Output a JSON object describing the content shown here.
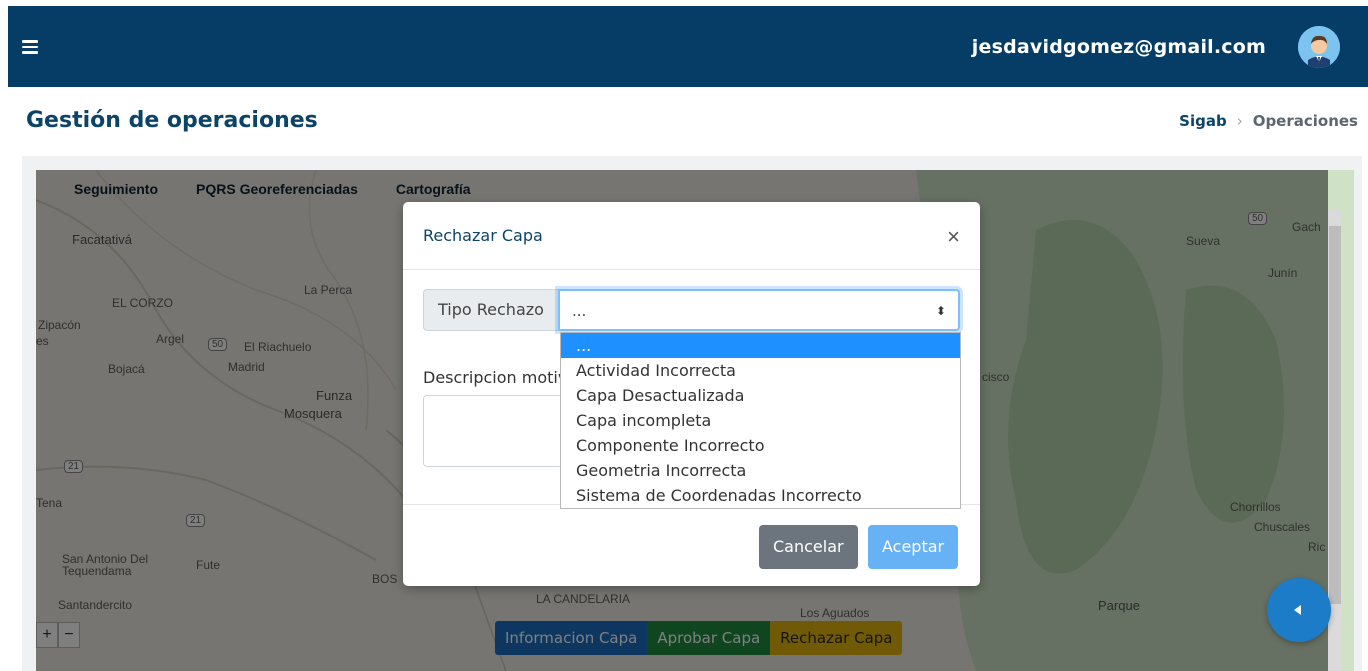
{
  "header": {
    "user_email": "jesdavidgomez@gmail.com"
  },
  "page": {
    "title": "Gestión de operaciones",
    "breadcrumb": [
      "Sigab",
      "Operaciones"
    ]
  },
  "map": {
    "tabs": [
      "Seguimiento",
      "PQRS Georeferenciadas",
      "Cartografía"
    ],
    "labels": {
      "facatativa": "Facatativá",
      "el_corzo": "EL CORZO",
      "la_perca": "La Perca",
      "zipacon": "Zipacón",
      "argel": "Argel",
      "el_riachuelo": "El Riachuelo",
      "bojaca": "Bojacá",
      "madrid": "Madrid",
      "funza": "Funza",
      "mosquera": "Mosquera",
      "tena": "Tena",
      "san_antonio": "San Antonio Del",
      "tequendama": "Tequendama",
      "fute": "Fute",
      "santandercito": "Santandercito",
      "la_candelaria": "LA CANDELARIA",
      "los_aguados": "Los Aguados",
      "sueva": "Sueva",
      "junin": "Junín",
      "gach": "Gach",
      "cisco": "cisco",
      "chorrillos": "Chorrillos",
      "chuscales": "Chuscales",
      "ric": "Ric",
      "parque": "Parque",
      "bos": "BOS",
      "es": "es"
    },
    "road_shields": [
      "50",
      "21",
      "21",
      "50",
      "21"
    ],
    "zoom_in": "+",
    "zoom_out": "−"
  },
  "bottom_actions": {
    "info": "Informacion Capa",
    "approve": "Aprobar Capa",
    "reject": "Rechazar Capa"
  },
  "modal": {
    "title": "Rechazar Capa",
    "close": "×",
    "tipo_label": "Tipo Rechazo",
    "tipo_selected": "...",
    "tipo_arrows": "⬍",
    "descripcion_label": "Descripcion motivo",
    "descripcion_value": "",
    "cancel": "Cancelar",
    "accept": "Aceptar"
  },
  "dropdown_options": [
    "...",
    "Actividad Incorrecta",
    "Capa Desactualizada",
    "Capa incompleta",
    "Componente Incorrecto",
    "Geometria Incorrecta",
    "Sistema de Coordenadas Incorrecto"
  ],
  "colors": {
    "header_bg": "#053d66",
    "title": "#0c4468",
    "select_highlight": "#1e90ff",
    "btn_info": "#1a6ec2",
    "btn_approve": "#1f8b3f",
    "btn_reject": "#e3b50c",
    "fab": "#1c7cc7"
  }
}
